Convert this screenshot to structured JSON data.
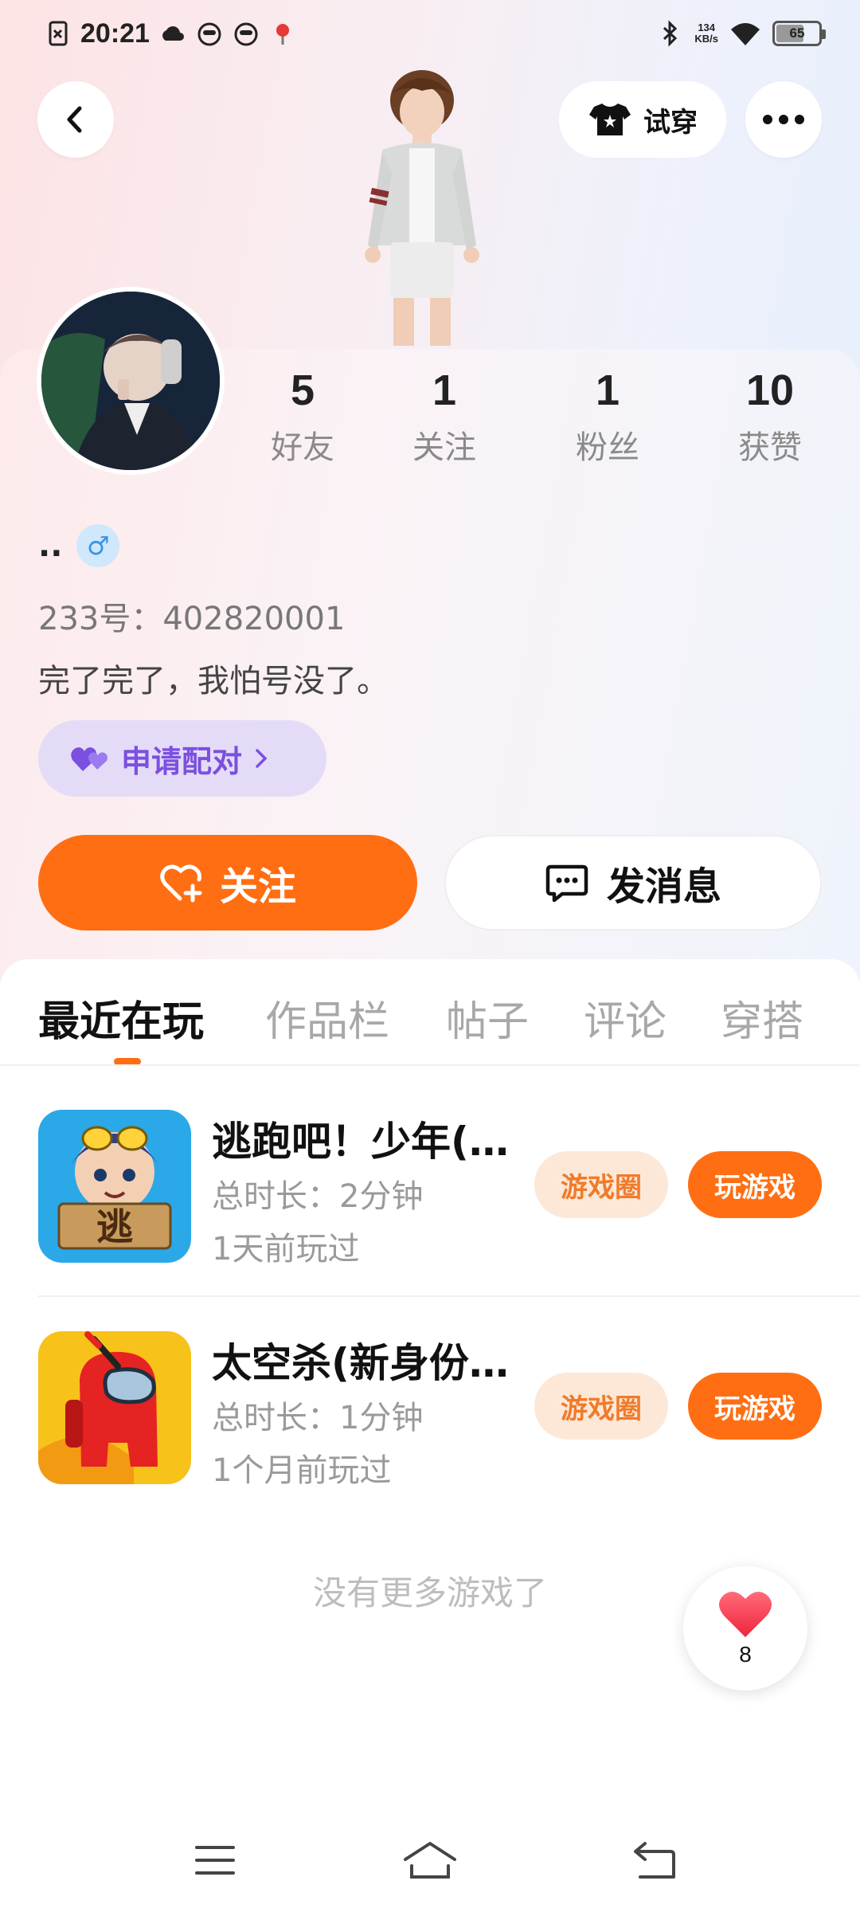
{
  "status_bar": {
    "time": "20:21",
    "net_speed_value": "134",
    "net_speed_unit": "KB/s",
    "battery": "65",
    "battery_level": 0.65
  },
  "header": {
    "try_on_label": "试穿",
    "back_icon": "back-icon",
    "more_icon": "more-icon"
  },
  "profile": {
    "nickname": "..",
    "gender": "♂",
    "uid_line": "233号：402820001",
    "bio": "完了完了，我怕号没了。",
    "pair_label": "申请配对",
    "stats": [
      {
        "num": "5",
        "label": "好友"
      },
      {
        "num": "1",
        "label": "关注"
      },
      {
        "num": "1",
        "label": "粉丝"
      },
      {
        "num": "10",
        "label": "获赞"
      }
    ]
  },
  "actions": {
    "follow_label": "关注",
    "message_label": "发消息"
  },
  "tabs": [
    "最近在玩",
    "作品栏",
    "帖子",
    "评论",
    "穿搭"
  ],
  "active_tab": 0,
  "games": [
    {
      "title": "逃跑吧！少年(…",
      "duration": "总时长：2分钟",
      "last_played": "1天前玩过",
      "circle_label": "游戏圈",
      "play_label": "玩游戏",
      "icon_text": "逃"
    },
    {
      "title": "太空杀(新身份…",
      "duration": "总时长：1分钟",
      "last_played": "1个月前玩过",
      "circle_label": "游戏圈",
      "play_label": "玩游戏"
    }
  ],
  "no_more_text": "没有更多游戏了",
  "likes_fab": {
    "count": "8"
  },
  "colors": {
    "accent": "#ff6e12",
    "pair": "#7b4fe0",
    "pill_bg": "#fde8d8"
  }
}
